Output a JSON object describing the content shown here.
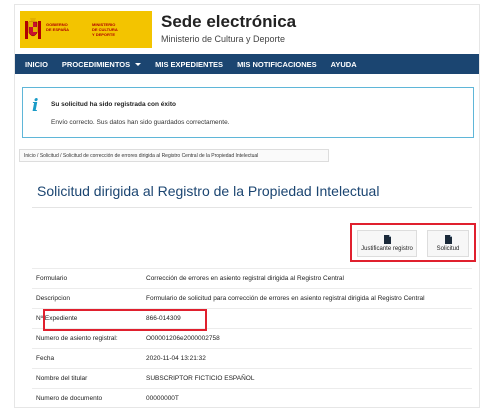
{
  "header": {
    "logo_text_left": "GOBIERNO\nDE ESPAÑA",
    "logo_text_right": "MINISTERIO\nDE CULTURA\nY DEPORTE",
    "title": "Sede electrónica",
    "subtitle": "Ministerio de Cultura y Deporte",
    "logo_color": "#f3c400"
  },
  "nav": {
    "items": [
      {
        "label": "INICIO"
      },
      {
        "label": "PROCEDIMIENTOS"
      },
      {
        "label": "MIS EXPEDIENTES"
      },
      {
        "label": "MIS NOTIFICACIONES"
      },
      {
        "label": "AYUDA"
      }
    ],
    "color": "#1b4571"
  },
  "alert": {
    "icon": "info-icon",
    "title": "Su solicitud ha sido registrada con éxito",
    "text": "Envío correcto. Sus datos han sido guardados correctamente."
  },
  "breadcrumb": "Inicio / Solicitud / Solicitud de corrección de errores dirigida al Registro Central de la Propiedad Intelectual",
  "main": {
    "title": "Solicitud dirigida al Registro de la Propiedad Intelectual",
    "actions": {
      "justificante": "Justificante registro",
      "solicitud": "Solicitud"
    },
    "fields": [
      {
        "key": "Formulario",
        "value": "Corrección de errores en asiento registral dirigida al Registro Central"
      },
      {
        "key": "Descripcion",
        "value": "Formulario de solicitud para corrección de errores en asiento registral dirigida al Registro Central"
      },
      {
        "key": "Nº Expediente",
        "value": "866-014309"
      },
      {
        "key": "Numero de asiento registral:",
        "value": "O00001206e2000002758"
      },
      {
        "key": "Fecha",
        "value": "2020-11-04 13:21:32"
      },
      {
        "key": "Nombre del titular",
        "value": "SUBSCRIPTOR FICTICIO ESPAÑOL"
      },
      {
        "key": "Numero de documento",
        "value": "00000000T"
      }
    ],
    "highlight_color": "#e0202e"
  }
}
